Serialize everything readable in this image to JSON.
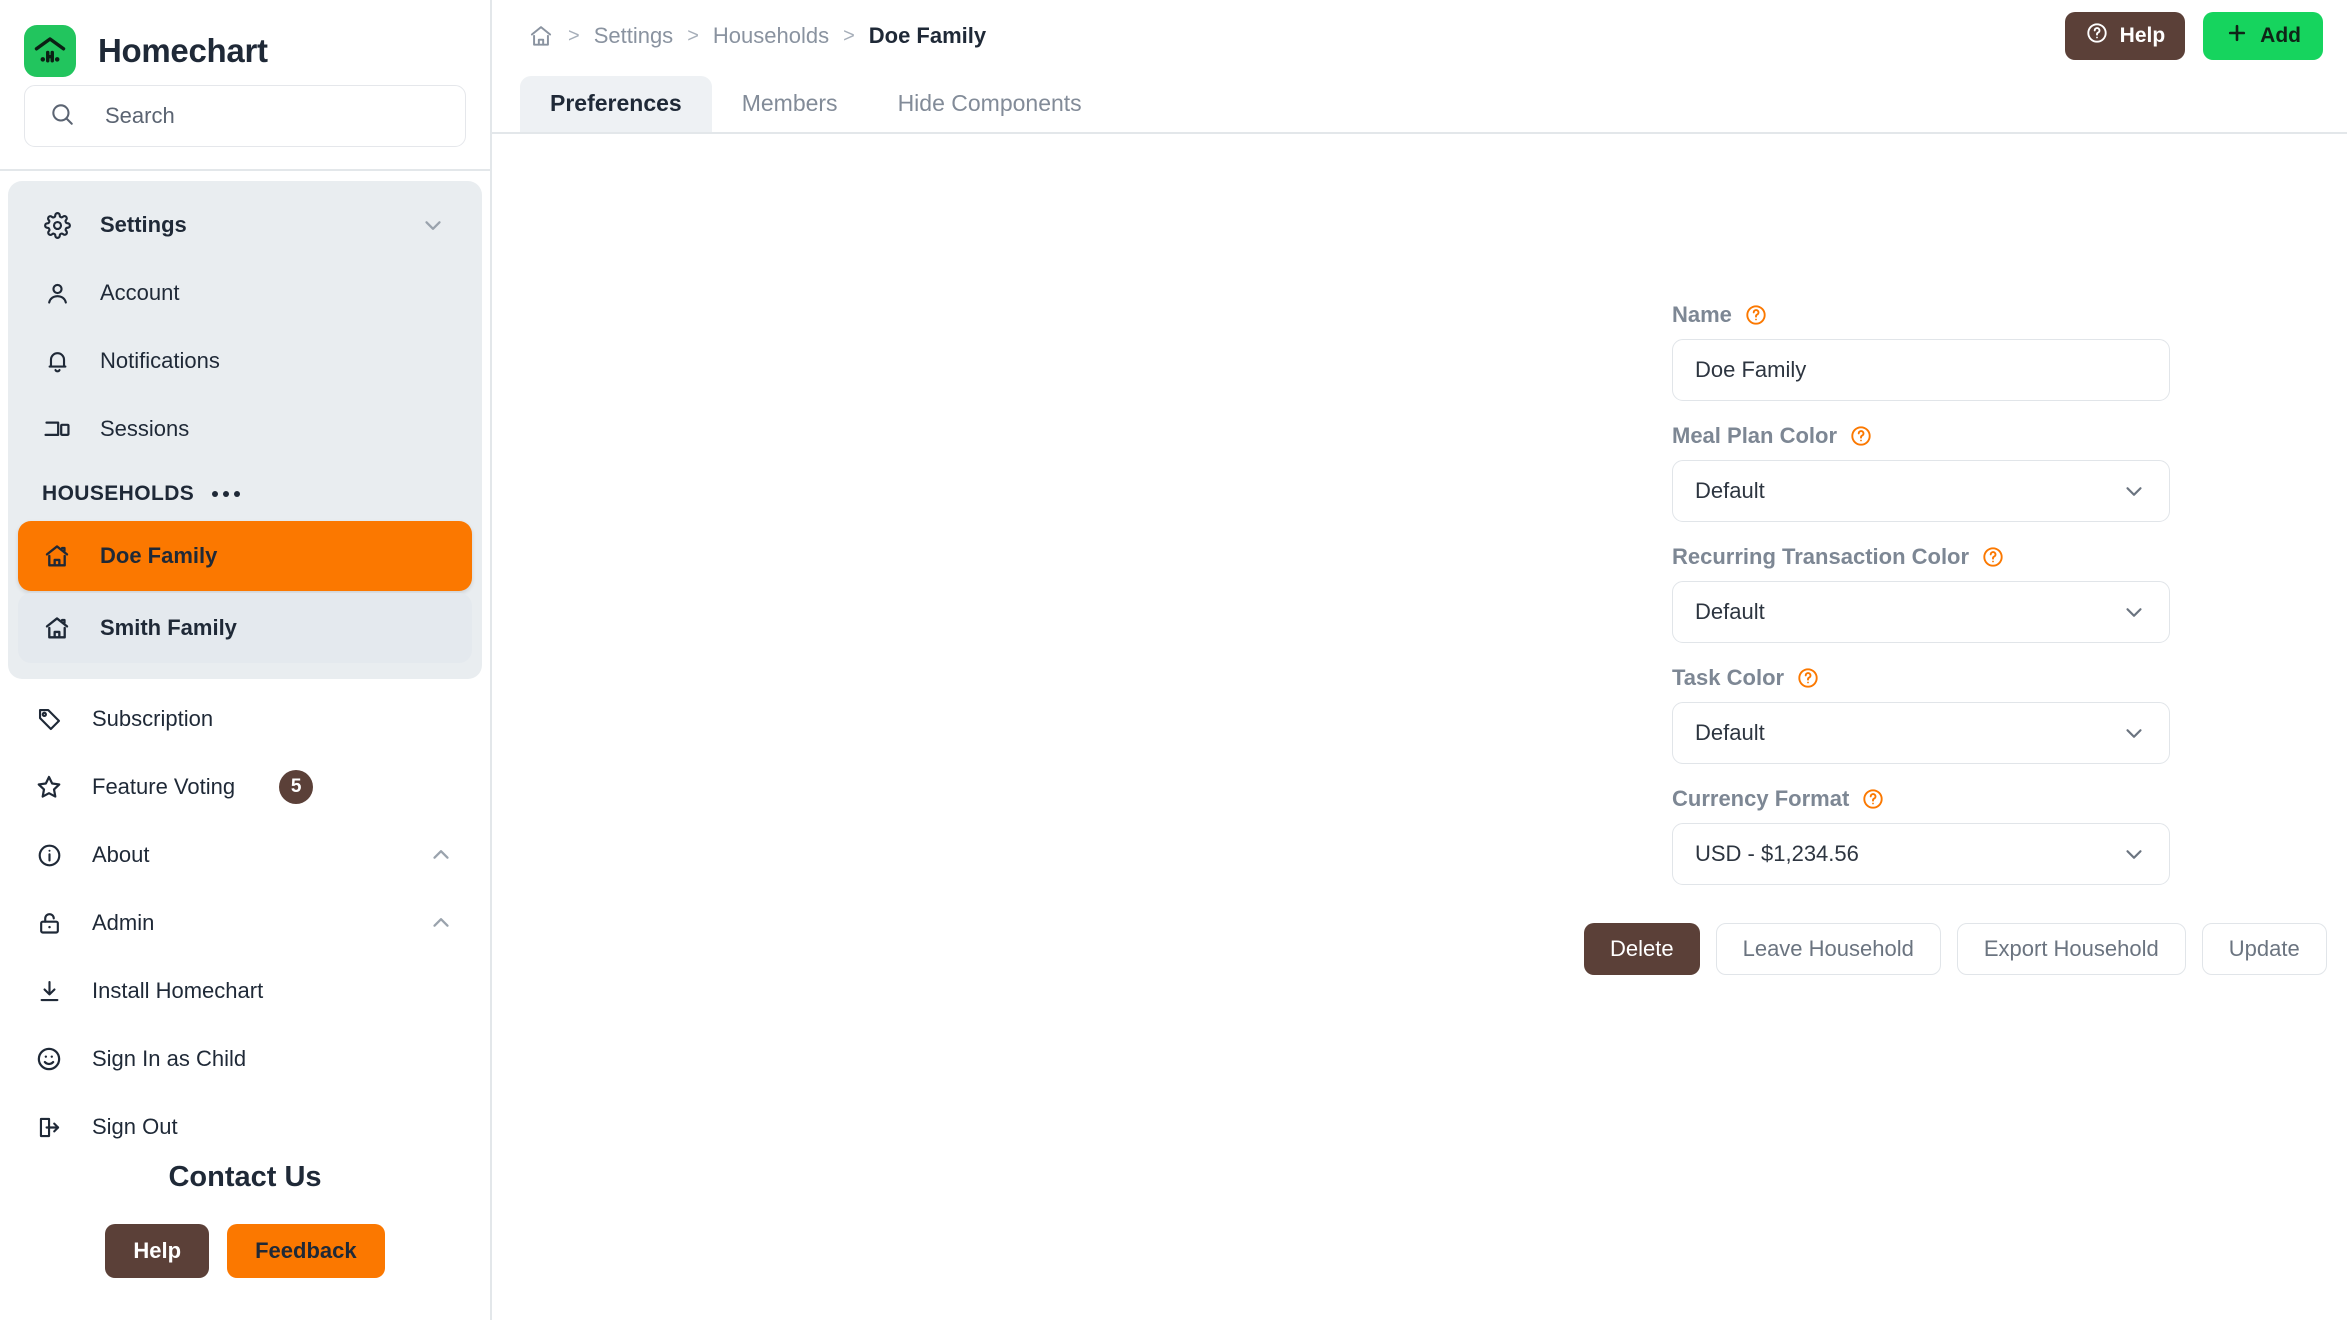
{
  "brand": {
    "name": "Homechart",
    "logo_icon": "homechart-logo-icon",
    "logo_color": "#22c55e"
  },
  "search": {
    "placeholder": "Search",
    "icon": "search-icon"
  },
  "sidebar": {
    "settings_group": {
      "label": "Settings",
      "icon": "gear-icon",
      "chevron": "chevron-down-icon"
    },
    "settings_items": [
      {
        "label": "Account",
        "icon": "person-icon"
      },
      {
        "label": "Notifications",
        "icon": "bell-icon"
      },
      {
        "label": "Sessions",
        "icon": "devices-icon"
      }
    ],
    "households_section": {
      "title": "HOUSEHOLDS",
      "menu_icon": "ellipsis-icon"
    },
    "households": [
      {
        "label": "Doe Family",
        "icon": "house-icon",
        "active": true
      },
      {
        "label": "Smith Family",
        "icon": "house-icon",
        "active": false
      }
    ],
    "lower_items": [
      {
        "label": "Subscription",
        "icon": "tag-icon",
        "badge": null,
        "chevron": null
      },
      {
        "label": "Feature Voting",
        "icon": "star-icon",
        "badge": "5",
        "chevron": null
      },
      {
        "label": "About",
        "icon": "info-circle-icon",
        "badge": null,
        "chevron": "chevron-up-icon"
      },
      {
        "label": "Admin",
        "icon": "lock-icon",
        "badge": null,
        "chevron": "chevron-up-icon"
      },
      {
        "label": "Install Homechart",
        "icon": "download-icon",
        "badge": null,
        "chevron": null
      },
      {
        "label": "Sign In as Child",
        "icon": "child-face-icon",
        "badge": null,
        "chevron": null
      },
      {
        "label": "Sign Out",
        "icon": "sign-out-icon",
        "badge": null,
        "chevron": null
      }
    ],
    "contact": {
      "title": "Contact Us",
      "help_label": "Help",
      "feedback_label": "Feedback",
      "help_color": "#5b4038",
      "feedback_color": "#fb7800"
    }
  },
  "header": {
    "breadcrumb": [
      {
        "label": "",
        "icon": "home-icon",
        "current": false
      },
      {
        "label": "Settings",
        "icon": null,
        "current": false
      },
      {
        "label": "Households",
        "icon": null,
        "current": false
      },
      {
        "label": "Doe Family",
        "icon": null,
        "current": true
      }
    ],
    "separator": ">",
    "help_label": "Help",
    "help_icon": "question-circle-icon",
    "add_label": "Add",
    "add_icon": "plus-icon",
    "add_color": "#16d45e"
  },
  "tabs": [
    {
      "label": "Preferences",
      "active": true
    },
    {
      "label": "Members",
      "active": false
    },
    {
      "label": "Hide Components",
      "active": false
    }
  ],
  "form": {
    "help_icon": "question-circle-icon",
    "chevron_icon": "chevron-down-icon",
    "fields": [
      {
        "label": "Name",
        "type": "text",
        "value": "Doe Family"
      },
      {
        "label": "Meal Plan Color",
        "type": "select",
        "value": "Default"
      },
      {
        "label": "Recurring Transaction Color",
        "type": "select",
        "value": "Default"
      },
      {
        "label": "Task Color",
        "type": "select",
        "value": "Default"
      },
      {
        "label": "Currency Format",
        "type": "select",
        "value": "USD - $1,234.56"
      }
    ],
    "buttons": [
      {
        "label": "Delete",
        "style": "danger"
      },
      {
        "label": "Leave Household",
        "style": "ghost"
      },
      {
        "label": "Export Household",
        "style": "ghost"
      },
      {
        "label": "Update",
        "style": "ghost"
      }
    ]
  },
  "colors": {
    "accent_orange": "#fb7800",
    "brand_green": "#22c55e",
    "brown": "#5b4038",
    "panel": "#e9edf0"
  }
}
